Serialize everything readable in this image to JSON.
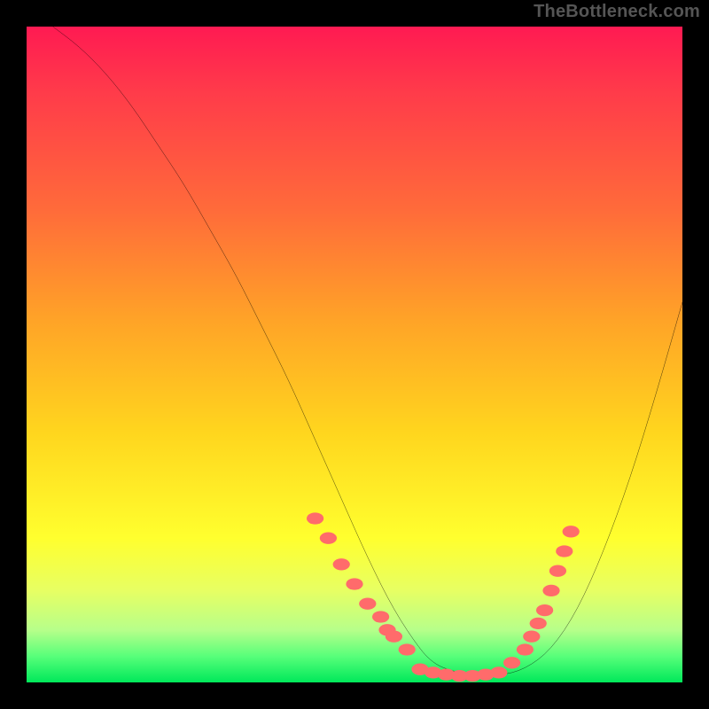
{
  "watermark": "TheBottleneck.com",
  "chart_data": {
    "type": "line",
    "title": "",
    "xlabel": "",
    "ylabel": "",
    "xlim": [
      0,
      100
    ],
    "ylim": [
      0,
      100
    ],
    "series": [
      {
        "name": "curve",
        "x": [
          4,
          8,
          12,
          16,
          20,
          24,
          28,
          32,
          36,
          40,
          44,
          48,
          52,
          56,
          60,
          62,
          64,
          68,
          72,
          76,
          80,
          84,
          88,
          92,
          96,
          100
        ],
        "y": [
          100,
          97,
          93,
          88,
          82,
          76,
          69,
          62,
          54,
          46,
          37,
          28,
          19,
          11,
          5,
          3,
          2,
          1,
          1,
          2,
          5,
          11,
          20,
          31,
          44,
          58
        ]
      },
      {
        "name": "dots-left",
        "x": [
          44,
          46,
          48,
          50,
          52,
          54,
          55,
          56,
          58
        ],
        "y": [
          25,
          22,
          18,
          15,
          12,
          10,
          8,
          7,
          5
        ]
      },
      {
        "name": "dots-bottom",
        "x": [
          60,
          62,
          64,
          66,
          68,
          70,
          72
        ],
        "y": [
          2,
          1.5,
          1.2,
          1,
          1,
          1.2,
          1.5
        ]
      },
      {
        "name": "dots-right",
        "x": [
          74,
          76,
          77,
          78,
          79,
          80,
          81,
          82,
          83
        ],
        "y": [
          3,
          5,
          7,
          9,
          11,
          14,
          17,
          20,
          23
        ]
      }
    ],
    "gradient_stops": [
      {
        "pos": 0,
        "color": "#ff1a52"
      },
      {
        "pos": 28,
        "color": "#ff6b3a"
      },
      {
        "pos": 62,
        "color": "#ffd61e"
      },
      {
        "pos": 86,
        "color": "#e7ff63"
      },
      {
        "pos": 100,
        "color": "#00e85a"
      }
    ]
  }
}
